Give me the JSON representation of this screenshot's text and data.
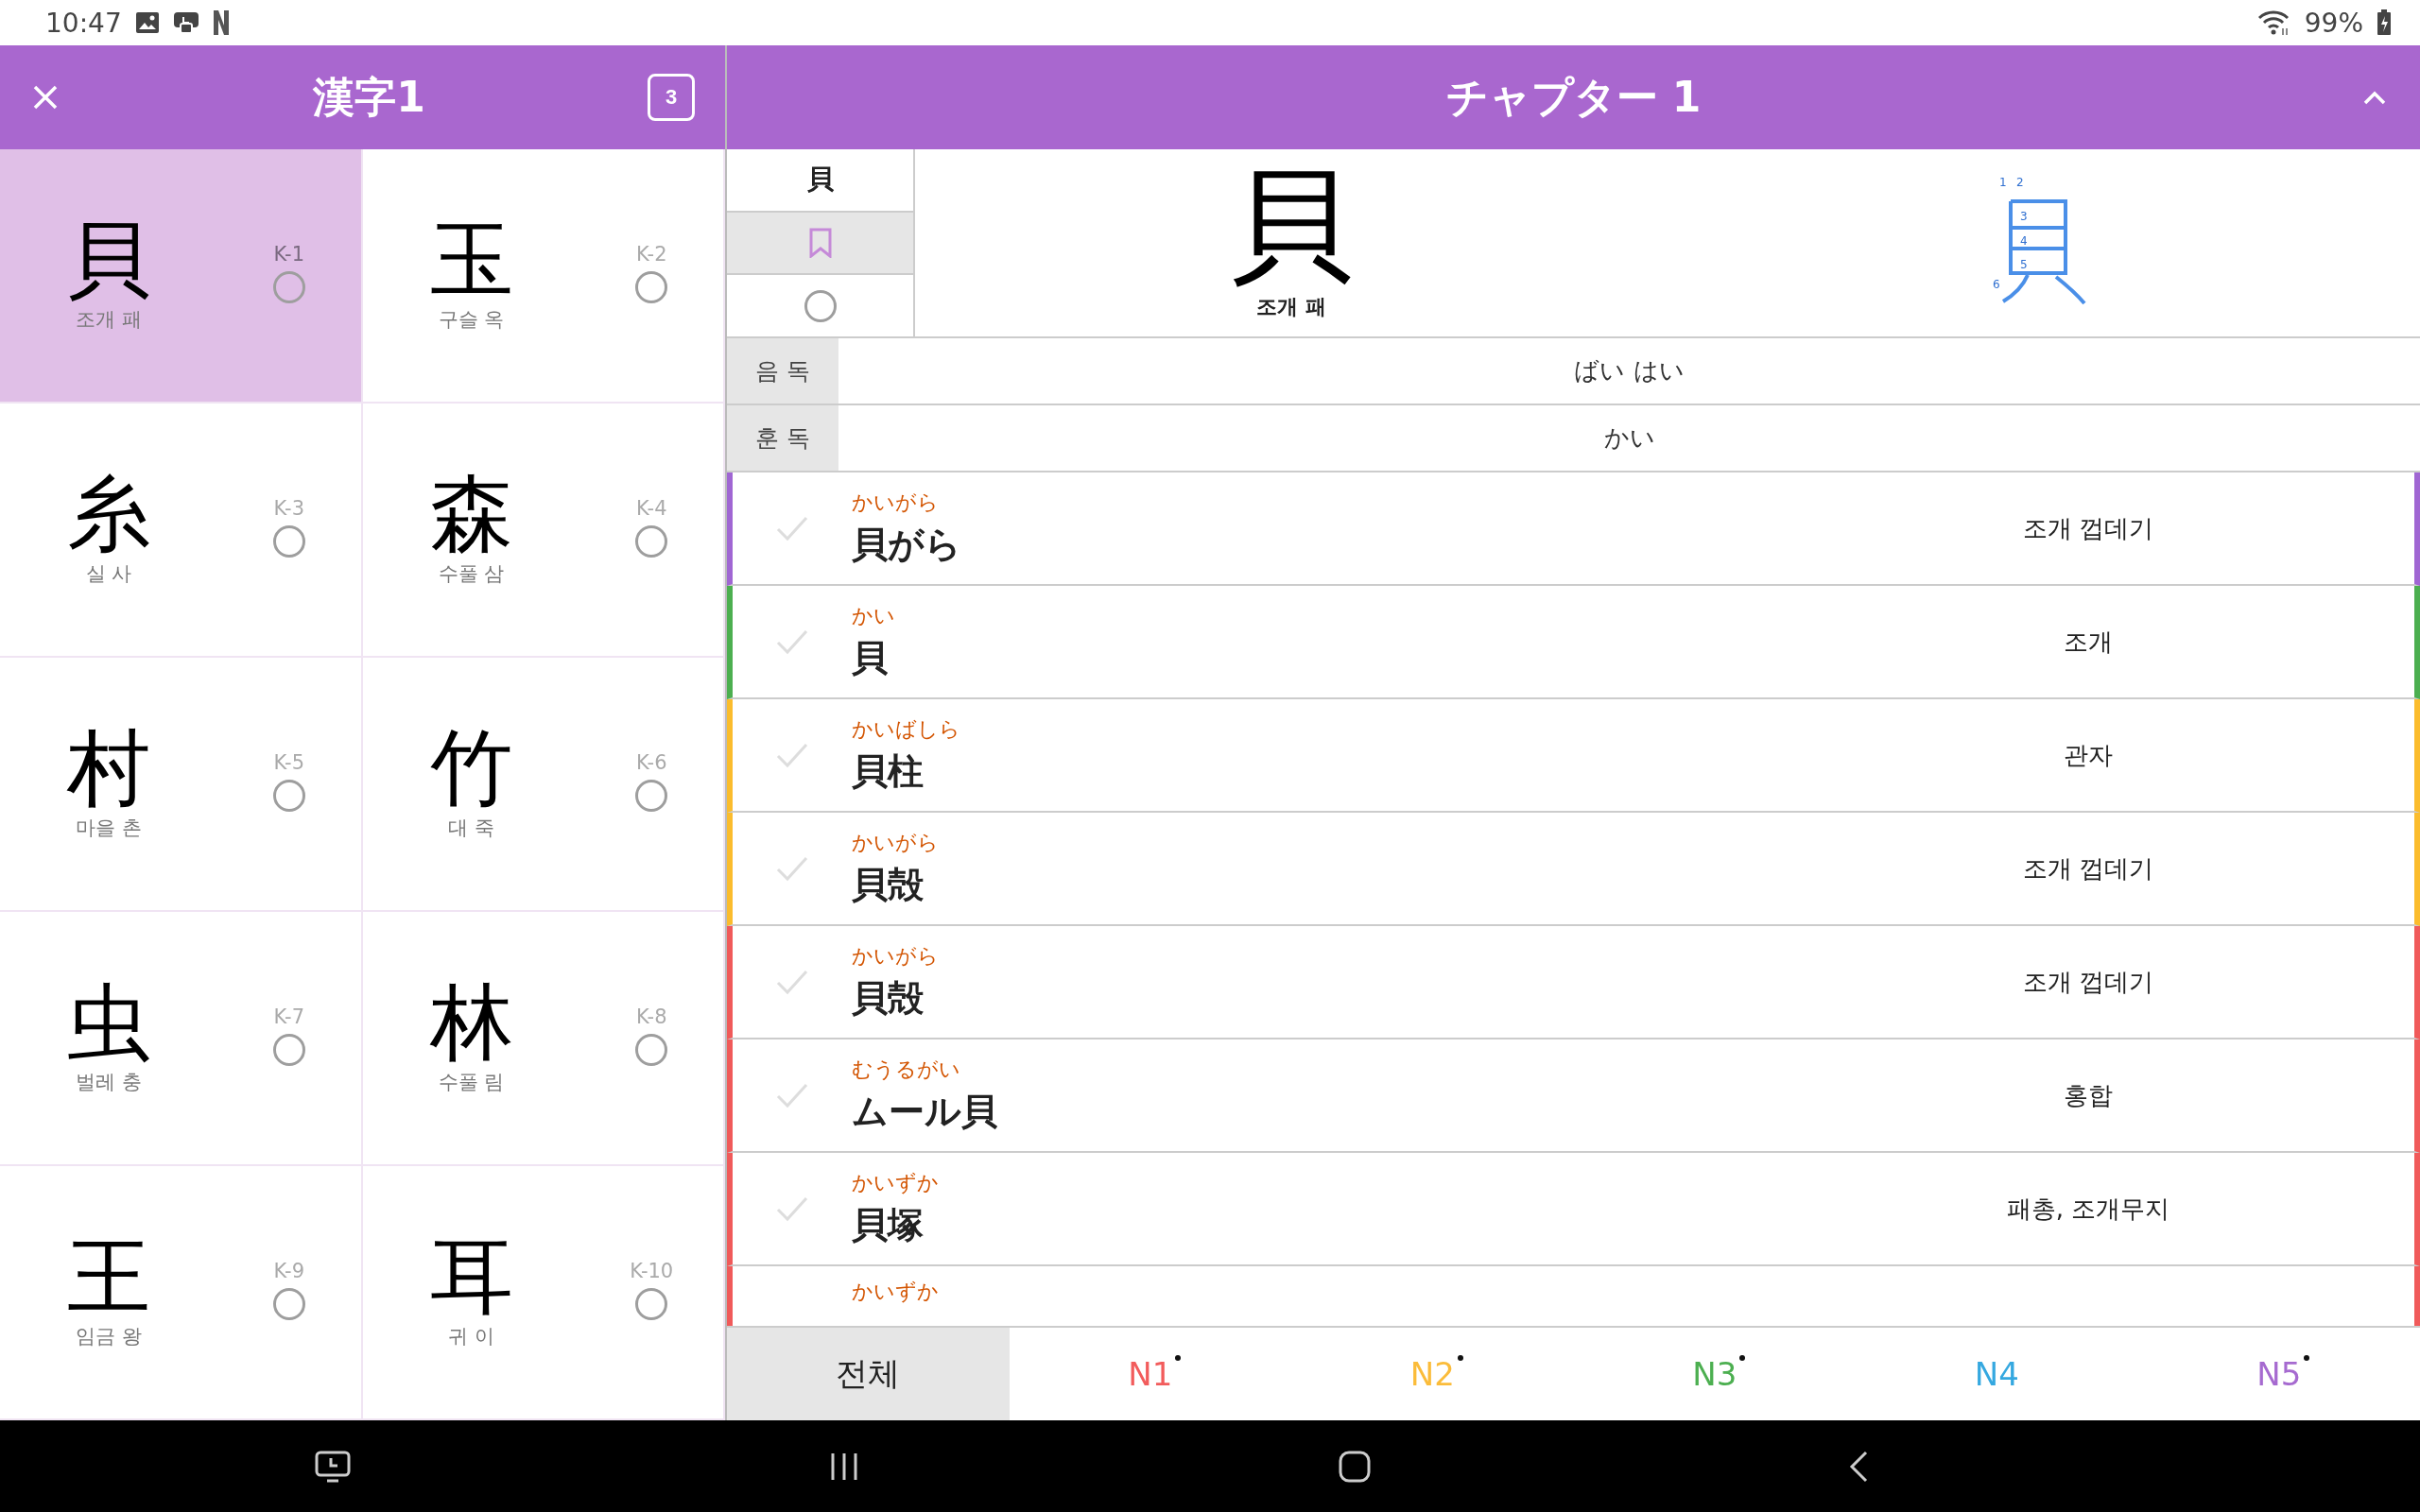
{
  "status_bar": {
    "time": "10:47",
    "battery": "99%"
  },
  "left_header": {
    "title": "漢字1",
    "count": "3"
  },
  "kanji_cards": [
    {
      "kanji": "貝",
      "meaning": "조개 패",
      "code": "K-1",
      "selected": true,
      "checked": false
    },
    {
      "kanji": "玉",
      "meaning": "구슬 옥",
      "code": "K-2",
      "selected": false,
      "checked": false
    },
    {
      "kanji": "糸",
      "meaning": "실 사",
      "code": "K-3",
      "selected": false,
      "checked": false
    },
    {
      "kanji": "森",
      "meaning": "수풀 삼",
      "code": "K-4",
      "selected": false,
      "checked": false
    },
    {
      "kanji": "村",
      "meaning": "마을 촌",
      "code": "K-5",
      "selected": false,
      "checked": false
    },
    {
      "kanji": "竹",
      "meaning": "대 죽",
      "code": "K-6",
      "selected": false,
      "checked": false
    },
    {
      "kanji": "虫",
      "meaning": "벌레 충",
      "code": "K-7",
      "selected": false,
      "checked": false
    },
    {
      "kanji": "林",
      "meaning": "수풀 림",
      "code": "K-8",
      "selected": false,
      "checked": false
    },
    {
      "kanji": "王",
      "meaning": "임금 왕",
      "code": "K-9",
      "selected": false,
      "checked": false
    },
    {
      "kanji": "耳",
      "meaning": "귀 이",
      "code": "K-10",
      "selected": false,
      "checked": false
    }
  ],
  "right_header": {
    "title": "チャプター 1"
  },
  "detail": {
    "kanji_small": "貝",
    "bookmarked": false,
    "checked": false,
    "kanji": "貝",
    "meaning": "조개 패",
    "stroke_numbers": [
      "1",
      "2",
      "3",
      "4",
      "5",
      "6"
    ]
  },
  "readings": [
    {
      "label": "음 독",
      "value": "ばい  はい"
    },
    {
      "label": "훈 독",
      "value": "かい"
    }
  ],
  "words": [
    {
      "reading": "かいがら",
      "word": "貝がら",
      "meaning": "조개 껍데기",
      "color": "#a066d3",
      "checked": false
    },
    {
      "reading": "かい",
      "word": "貝",
      "meaning": "조개",
      "color": "#4caf50",
      "checked": false
    },
    {
      "reading": "かいばしら",
      "word": "貝柱",
      "meaning": "관자",
      "color": "#fbbc2d",
      "checked": false
    },
    {
      "reading": "かいがら",
      "word": "貝殻",
      "meaning": "조개 껍데기",
      "color": "#fbbc2d",
      "checked": false
    },
    {
      "reading": "かいがら",
      "word": "貝殻",
      "meaning": "조개 껍데기",
      "color": "#f05a5a",
      "checked": false
    },
    {
      "reading": "むうるがい",
      "word": "ムール貝",
      "meaning": "홍합",
      "color": "#f05a5a",
      "checked": false
    },
    {
      "reading": "かいずか",
      "word": "貝塚",
      "meaning": "패총, 조개무지",
      "color": "#f05a5a",
      "checked": false
    },
    {
      "reading": "かいずか",
      "color": "#f05a5a"
    }
  ],
  "level_tabs": [
    {
      "label": "전체",
      "selected": true,
      "color": "#222222",
      "marked": false
    },
    {
      "label": "N1",
      "selected": false,
      "color": "#f25c5c",
      "marked": true
    },
    {
      "label": "N2",
      "selected": false,
      "color": "#fbbc3a",
      "marked": true
    },
    {
      "label": "N3",
      "selected": false,
      "color": "#4caf50",
      "marked": true
    },
    {
      "label": "N4",
      "selected": false,
      "color": "#35a8e0",
      "marked": false
    },
    {
      "label": "N5",
      "selected": false,
      "color": "#a66ad0",
      "marked": true
    }
  ]
}
